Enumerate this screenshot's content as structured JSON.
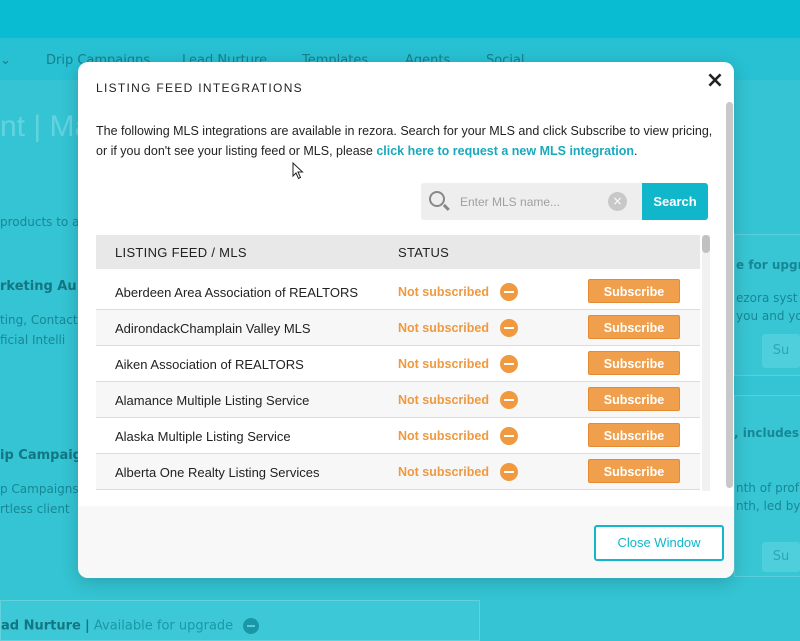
{
  "background": {
    "nav_items": [
      "Drip Campaigns",
      "Lead Nurture",
      "Templates",
      "Agents",
      "Social"
    ],
    "page_title": "nt | Ma",
    "left_texts": [
      "products to all",
      "rketing Au",
      "ting, Contact",
      "ficial Intelli",
      "ip Campaig",
      "p Campaigns",
      "rtless client"
    ],
    "right_texts": [
      "e for upgr",
      "ezora syst",
      "you and yo",
      ", includes",
      "nth of prof",
      "nth, led by",
      "Su",
      "Su"
    ],
    "bottom_card": {
      "heading": "ad Nurture",
      "separator": "|",
      "availability": "Available for upgrade"
    }
  },
  "modal": {
    "title": "LISTING FEED INTEGRATIONS",
    "close_icon": "×",
    "intro_text": "The following MLS integrations are available in rezora. Search for your MLS and click Subscribe to view pricing, or if you don't see your listing feed or MLS, please ",
    "intro_link": "click here to request a new MLS integration",
    "intro_end": ".",
    "search": {
      "placeholder": "Enter MLS name...",
      "clear_icon": "×",
      "button_label": "Search"
    },
    "table": {
      "headers": [
        "LISTING FEED / MLS",
        "STATUS"
      ],
      "rows": [
        {
          "name": "Aberdeen Area Association of REALTORS",
          "status": "Not subscribed",
          "action": "Subscribe"
        },
        {
          "name": "AdirondackChamplain Valley MLS",
          "status": "Not subscribed",
          "action": "Subscribe"
        },
        {
          "name": "Aiken Association of REALTORS",
          "status": "Not subscribed",
          "action": "Subscribe"
        },
        {
          "name": "Alamance Multiple Listing Service",
          "status": "Not subscribed",
          "action": "Subscribe"
        },
        {
          "name": "Alaska Multiple Listing Service",
          "status": "Not subscribed",
          "action": "Subscribe"
        },
        {
          "name": "Alberta One Realty Listing Services",
          "status": "Not subscribed",
          "action": "Subscribe"
        }
      ]
    },
    "close_window_label": "Close Window"
  },
  "colors": {
    "accent": "#10b6c9",
    "status_orange": "#f0993e",
    "subscribe_btn": "#f0a04c"
  }
}
